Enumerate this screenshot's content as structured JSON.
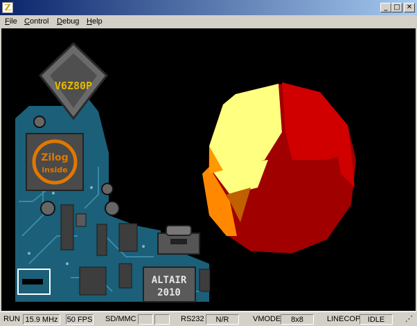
{
  "window": {
    "title": "",
    "app_icon_glyph": "Z",
    "minimize_glyph": "_",
    "maximize_glyph": "□",
    "close_glyph": "✕"
  },
  "menu": {
    "items": [
      {
        "label": "File"
      },
      {
        "label": "Control"
      },
      {
        "label": "Debug"
      },
      {
        "label": "Help"
      }
    ]
  },
  "screen": {
    "chip_label": "V6Z80P",
    "zilog_line1": "Zilog",
    "zilog_line2": "inside",
    "altair_line1": "ALTAIR",
    "altair_line2": "2010"
  },
  "status": {
    "run_label": "RUN",
    "clock": "15.9 MHz",
    "fps": "50 FPS",
    "sdmmc_label": "SD/MMC",
    "sdmmc_value_1": "",
    "sdmmc_value_2": "",
    "rs232_label": "RS232",
    "rs232_value": "N/R",
    "vmode_label": "VMODE",
    "vmode_value": "8x8",
    "linecop_label": "LINECOP",
    "linecop_value": "IDLE"
  },
  "colors": {
    "titlebar_start": "#0a246a",
    "titlebar_end": "#a6caf0",
    "board": "#1b5f78",
    "chip": "#5a5a5a",
    "chip_label": "#e8b800",
    "ball_yellow": "#ffff80",
    "ball_red": "#d00000",
    "ball_darkred": "#a00000",
    "ball_orange": "#ff8800"
  }
}
